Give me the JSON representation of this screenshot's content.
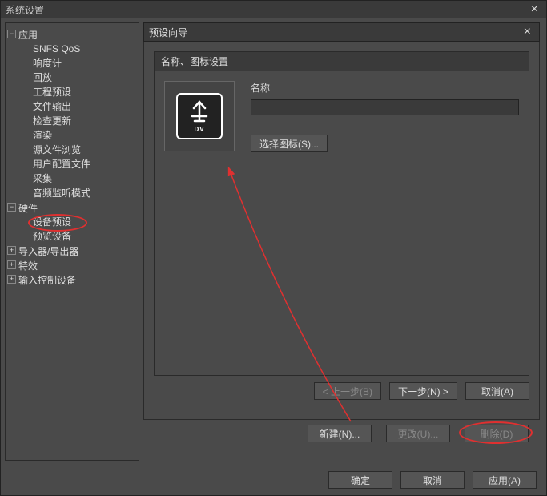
{
  "outer": {
    "title": "系统设置",
    "close": "×",
    "ok": "确定",
    "cancel": "取消",
    "apply": "应用(A)"
  },
  "tree": {
    "app": {
      "label": "应用",
      "children": [
        "SNFS QoS",
        "响度计",
        "回放",
        "工程预设",
        "文件输出",
        "检查更新",
        "渲染",
        "源文件浏览",
        "用户配置文件",
        "采集",
        "音频监听模式"
      ]
    },
    "hardware": {
      "label": "硬件",
      "children": [
        "设备预设",
        "预览设备"
      ]
    },
    "importer": {
      "label": "导入器/导出器"
    },
    "fx": {
      "label": "特效"
    },
    "input": {
      "label": "输入控制设备"
    }
  },
  "wizard": {
    "title": "预设向导",
    "close": "×",
    "section_title": "名称、图标设置",
    "name_label": "名称",
    "name_value": "",
    "icon_label": "DV",
    "select_icon": "选择图标(S)...",
    "prev": "< 上一步(B)",
    "next": "下一步(N) >",
    "cancel": "取消(A)"
  },
  "device_buttons": {
    "new": "新建(N)...",
    "change": "更改(U)...",
    "delete": "删除(D)"
  }
}
